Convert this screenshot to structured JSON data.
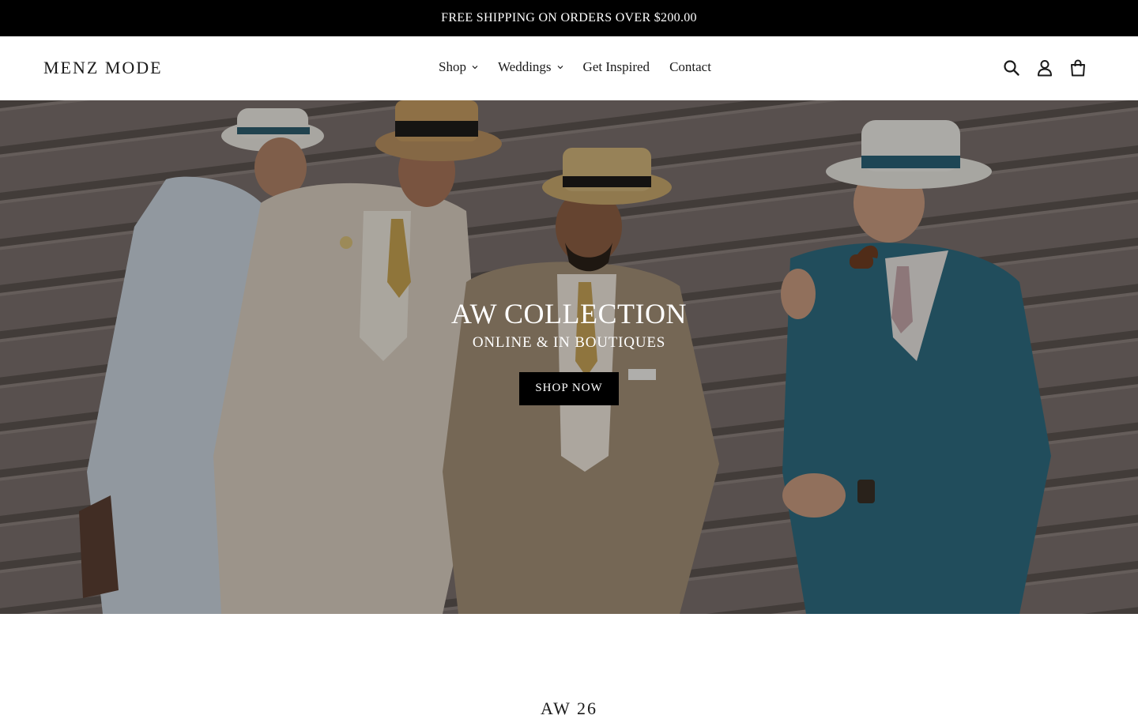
{
  "announcement": {
    "text": "FREE SHIPPING ON ORDERS OVER $200.00"
  },
  "header": {
    "logo": "MENZ MODE",
    "nav": [
      {
        "label": "Shop",
        "has_dropdown": true
      },
      {
        "label": "Weddings",
        "has_dropdown": true
      },
      {
        "label": "Get Inspired",
        "has_dropdown": false
      },
      {
        "label": "Contact",
        "has_dropdown": false
      }
    ],
    "icons": [
      "search-icon",
      "account-icon",
      "cart-icon"
    ]
  },
  "hero": {
    "title": "AW COLLECTION",
    "subtitle": "ONLINE & IN BOUTIQUES",
    "button_label": "SHOP NOW"
  },
  "featured": {
    "heading": "AW 26"
  },
  "colors": {
    "announcement_bg": "#000000",
    "button_bg": "#000000",
    "text": "#1b1b1b"
  }
}
